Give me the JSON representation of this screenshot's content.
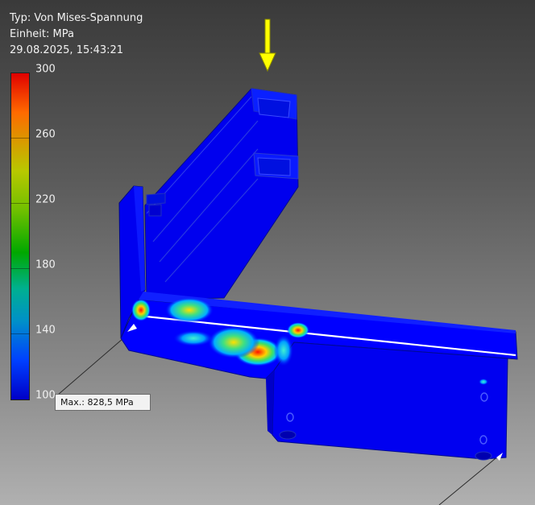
{
  "result_info": {
    "type_line": "Typ: Von Mises-Spannung",
    "unit_line": "Einheit: MPa",
    "timestamp_line": "29.08.2025, 15:43:21"
  },
  "color_scale": {
    "labels": [
      "300",
      "260",
      "220",
      "180",
      "140",
      "100"
    ],
    "colors": [
      "#ff0000",
      "#ff8c00",
      "#c8c800",
      "#00b400",
      "#00aaaa",
      "#0000ff"
    ]
  },
  "probe": {
    "label": "Max.: 828,5 MPa"
  },
  "load_arrow": {
    "color": "#ffff00"
  }
}
